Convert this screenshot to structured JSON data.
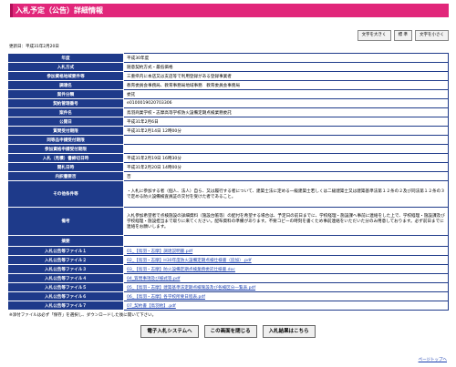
{
  "page_title": "入札予定（公告）詳細情報",
  "font_buttons": [
    "文字を大きく",
    "標 準",
    "文字を小さく"
  ],
  "updated": "更新日：平成31年2月20日",
  "rows": [
    {
      "label": "年度",
      "value": "平成30年度"
    },
    {
      "label": "入札方式",
      "value": "随意契約方式・最低価格"
    },
    {
      "label": "参加資格地域要件等",
      "value": "三重県内に本店又は支店等で利用登録がある登録事業者"
    },
    {
      "label": "調達名",
      "value": "教育委員会事務局、教育事務局地域事務　教育委員会事務局"
    },
    {
      "label": "案件分類",
      "value": "委託"
    },
    {
      "label": "契約管理番号",
      "value": "e0100019020703306"
    },
    {
      "label": "案件名",
      "value": "鳥羽商業学校・志摩高等学校防火設備定期点検業務委託"
    },
    {
      "label": "公開日",
      "value": "平成31年2月6日"
    },
    {
      "label": "質問受付期限",
      "value": "平成31年2月14日 12時00分"
    },
    {
      "label": "同等品申請受付期限",
      "value": ""
    },
    {
      "label": "参加資格申請受付期限",
      "value": ""
    },
    {
      "label": "入札（見積）書締切日時",
      "value": "平成31年2月19日 16時30分"
    },
    {
      "label": "開札日時",
      "value": "平成31年2月20日 14時00分"
    },
    {
      "label": "内訳書要否",
      "value": "否"
    }
  ],
  "other_conditions": {
    "label": "その他条件等",
    "value": "・入札に参加する者（個人、法人）自ら、又は履行する者について、建築士法に定める一級建築士若しくは二級建築士又は建築基準法第１２条の２及び同法第１２条の３で定める防火設備検査員証の交付を受けた者であること。"
  },
  "remarks": {
    "label": "備考",
    "value": "入札参加希望者で点検施設の詳細資料（施設台帳等）の配付を希望する場合は、予定日の前日までに、学校経理・施設課へ事前に連絡をした上で、学校経理・施設課及び学校経理・施設担当まで取りに来てください。配布資料の準備があります。不要コピーの時刻を書くため事前連絡をいただいた分のみ用意しております。必ず前日までに連絡をお願いします。"
  },
  "summary": {
    "label": "摘要",
    "value": ""
  },
  "files": [
    {
      "label": "入札公告等ファイル１",
      "value": "01_【鳥羽・志摩】調達説明書.pdf"
    },
    {
      "label": "入札公告等ファイル２",
      "value": "02_【鳥羽・志摩】H30年度防火設備定期点検仕様書（追加）.pdf"
    },
    {
      "label": "入札公告等ファイル３",
      "value": "03_【鳥羽・志摩】防火設備定期点検業務委託仕様書.doc"
    },
    {
      "label": "入札公告等ファイル４",
      "value": "04_質問事項及び様式等.pdf"
    },
    {
      "label": "入札公告等ファイル５",
      "value": "05_【鳥羽・志摩】建築基準法定期点検施設及び各検区分一覧表.pdf"
    },
    {
      "label": "入札公告等ファイル６",
      "value": "06_【鳥羽・志摩】各学校所要日程表.pdf"
    },
    {
      "label": "入札公告等ファイル７",
      "value": "07_契約書【鳥羽他】.pdf"
    }
  ],
  "note": "※添付ファイルは必ず「保存」を選択し、ダウンロードした後に開いて下さい。",
  "bottom_buttons": [
    "電子入札システムへ",
    "この画面を閉じる",
    "入札結果はこちら"
  ],
  "page_top": "ページトップへ"
}
